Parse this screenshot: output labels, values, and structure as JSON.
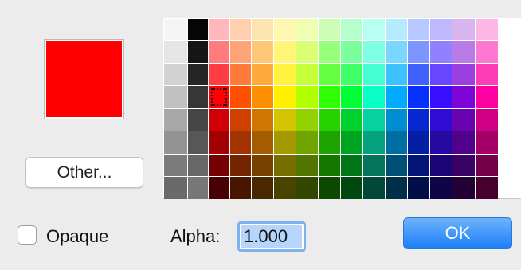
{
  "dialog": {
    "other_button_label": "Other...",
    "opaque_label": "Opaque",
    "opaque_checked": false,
    "alpha_label": "Alpha:",
    "alpha_value": "1.000",
    "ok_button_label": "OK"
  },
  "current_color": "#ff0000",
  "palette": {
    "columns": 15,
    "rows": 8,
    "selected": {
      "row": 3,
      "col": 2
    },
    "colors": [
      [
        "#f5f5f5",
        "#050505",
        "#ffb7bb",
        "#ffcfb0",
        "#fde3ae",
        "#fff7b0",
        "#efffb1",
        "#ccffb5",
        "#b5ffce",
        "#b7fff0",
        "#b5ebff",
        "#b7c7ff",
        "#c0b8ff",
        "#d8b5f1",
        "#fdb6e6"
      ],
      [
        "#e5e5e5",
        "#151515",
        "#ff7b7e",
        "#ffa476",
        "#fdc775",
        "#fff578",
        "#daff75",
        "#98ff7a",
        "#7bff9c",
        "#7fffe2",
        "#78d6ff",
        "#7d95ff",
        "#9180ff",
        "#b97be8",
        "#fd78cf"
      ],
      [
        "#d2d2d2",
        "#262626",
        "#ff3e44",
        "#ff7a3c",
        "#fdab3b",
        "#fff23e",
        "#c5ff39",
        "#64ff3f",
        "#3fff69",
        "#44ffd3",
        "#3ec1ff",
        "#4062ff",
        "#6647ff",
        "#9c3fe0",
        "#fd3db8"
      ],
      [
        "#c0c0c0",
        "#363636",
        "#ff0007",
        "#ff5000",
        "#fe9000",
        "#ffef00",
        "#b1ff00",
        "#2fff00",
        "#00ff37",
        "#09ffc4",
        "#01acff",
        "#0731ff",
        "#390fff",
        "#7e04d8",
        "#fd00a1"
      ],
      [
        "#a8a8a8",
        "#464646",
        "#d10006",
        "#d04100",
        "#d07500",
        "#d2c400",
        "#91d100",
        "#26d200",
        "#00d22d",
        "#07d1a1",
        "#018dd1",
        "#0628d1",
        "#2e0cd2",
        "#6703b1",
        "#cf0084"
      ],
      [
        "#939393",
        "#575757",
        "#a30004",
        "#a33300",
        "#a35c00",
        "#a49900",
        "#71a300",
        "#1da400",
        "#00a423",
        "#05a37d",
        "#006ea3",
        "#041fa3",
        "#240aa3",
        "#50028a",
        "#a20067"
      ],
      [
        "#7b7b7b",
        "#676767",
        "#750003",
        "#752400",
        "#754200",
        "#766e00",
        "#517500",
        "#157600",
        "#007619",
        "#04755a",
        "#004f75",
        "#031675",
        "#1a0775",
        "#390263",
        "#74004a"
      ],
      [
        "#6a6a6a",
        "#777777",
        "#480002",
        "#481600",
        "#482800",
        "#484400",
        "#324800",
        "#0d4800",
        "#00480f",
        "#024837",
        "#003048",
        "#020e48",
        "#100448",
        "#230135",
        "#47002d"
      ]
    ]
  }
}
